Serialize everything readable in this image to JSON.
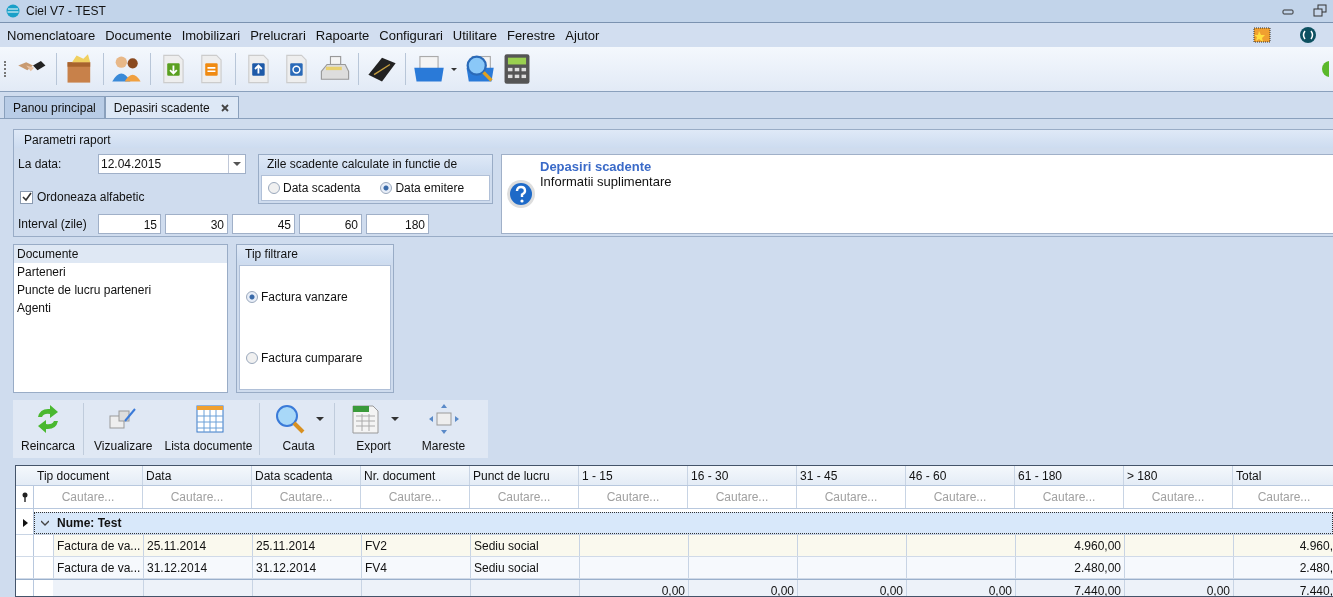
{
  "window": {
    "title": "Ciel V7 - TEST"
  },
  "menu": [
    "Nomenclatoare",
    "Documente",
    "Imobilizari",
    "Prelucrari",
    "Rapoarte",
    "Configurari",
    "Utilitare",
    "Ferestre",
    "Ajutor"
  ],
  "tabs": [
    {
      "label": "Panou principal",
      "selected": false,
      "closable": false
    },
    {
      "label": "Depasiri scadente",
      "selected": true,
      "closable": true
    }
  ],
  "parameters": {
    "title": "Parametri raport",
    "date_label": "La data:",
    "date_value": "12.04.2015",
    "sort_checkbox": {
      "label": "Ordoneaza alfabetic",
      "checked": true
    },
    "due_group": {
      "title": "Zile scadente calculate in functie de",
      "options": [
        {
          "label": "Data scadenta",
          "selected": false
        },
        {
          "label": "Data emitere",
          "selected": true
        }
      ]
    },
    "interval_label": "Interval (zile)",
    "intervals": [
      "15",
      "30",
      "45",
      "60",
      "180"
    ]
  },
  "info": {
    "title": "Depasiri scadente",
    "text": "Informatii suplimentare"
  },
  "grouping_list": [
    {
      "label": "Documente",
      "selected": true
    },
    {
      "label": "Parteneri",
      "selected": false
    },
    {
      "label": "Puncte de lucru parteneri",
      "selected": false
    },
    {
      "label": "Agenti",
      "selected": false
    }
  ],
  "filter": {
    "title": "Tip filtrare",
    "options": [
      {
        "label": "Factura vanzare",
        "selected": true
      },
      {
        "label": "Factura cumparare",
        "selected": false
      }
    ]
  },
  "report_toolbar": [
    {
      "label": "Reincarca",
      "kind": "reload",
      "dropdown": false,
      "separator_after": true
    },
    {
      "label": "Vizualizare",
      "kind": "view",
      "dropdown": false,
      "separator_after": false
    },
    {
      "label": "Lista documente",
      "kind": "list",
      "dropdown": false,
      "separator_after": true
    },
    {
      "label": "Cauta",
      "kind": "search",
      "dropdown": true,
      "separator_after": true
    },
    {
      "label": "Export",
      "kind": "export",
      "dropdown": true,
      "separator_after": false
    },
    {
      "label": "Mareste",
      "kind": "maximize",
      "dropdown": false,
      "separator_after": false
    }
  ],
  "grid": {
    "columns": [
      "Tip document",
      "Data",
      "Data scadenta",
      "Nr. document",
      "Punct de lucru",
      "1 - 15",
      "16 - 30",
      "31 - 45",
      "46 - 60",
      "61 - 180",
      "> 180",
      "Total"
    ],
    "filter_placeholders": [
      "Cautare...",
      "Cautare...",
      "Cautare...",
      "Cautare...",
      "Cautare...",
      "Cautare...",
      "Cautare...",
      "Cautare...",
      "Cautare...",
      "Cautare...",
      "Cautare...",
      "Cautare..."
    ],
    "group": {
      "label": "Nume: Test",
      "expanded": true
    },
    "rows": [
      {
        "selected": true,
        "cells": [
          "Factura de va...",
          "25.11.2014",
          "25.11.2014",
          "FV2",
          "Sediu social",
          "",
          "",
          "",
          "",
          "4.960,00",
          "",
          "4.960,"
        ]
      },
      {
        "selected": false,
        "cells": [
          "Factura de va...",
          "31.12.2014",
          "31.12.2014",
          "FV4",
          "Sediu social",
          "",
          "",
          "",
          "",
          "2.480,00",
          "",
          "2.480,"
        ]
      }
    ],
    "totals": [
      "0,00",
      "0,00",
      "0,00",
      "0,00",
      "7.440,00",
      "0,00",
      "7.440,"
    ]
  }
}
